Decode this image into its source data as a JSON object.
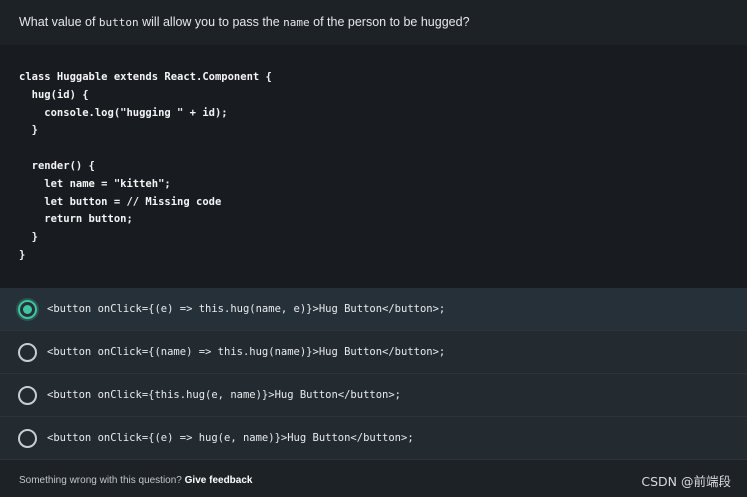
{
  "question": {
    "part1": "What value of ",
    "code1": "button",
    "part2": " will allow you to pass the ",
    "code2": "name",
    "part3": " of the person to be hugged?"
  },
  "code_block": {
    "code": "class Huggable extends React.Component {\n  hug(id) {\n    console.log(\"hugging \" + id);\n  }\n\n  render() {\n    let name = \"kitteh\";\n    let button = // Missing code\n    return button;\n  }\n}"
  },
  "options": [
    {
      "text": "<button onClick={(e) => this.hug(name, e)}>Hug Button</button>;",
      "selected": true
    },
    {
      "text": "<button onClick={(name) => this.hug(name)}>Hug Button</button>;",
      "selected": false
    },
    {
      "text": "<button onClick={this.hug(e, name)}>Hug Button</button>;",
      "selected": false
    },
    {
      "text": "<button onClick={(e) => hug(e, name)}>Hug Button</button>;",
      "selected": false
    }
  ],
  "footer": {
    "prompt": "Something wrong with this question? ",
    "link": "Give feedback"
  },
  "watermark": "CSDN @前端段",
  "colors": {
    "accent": "#3fc6a0",
    "background": "#1d2226",
    "code_background": "#181b1f"
  }
}
